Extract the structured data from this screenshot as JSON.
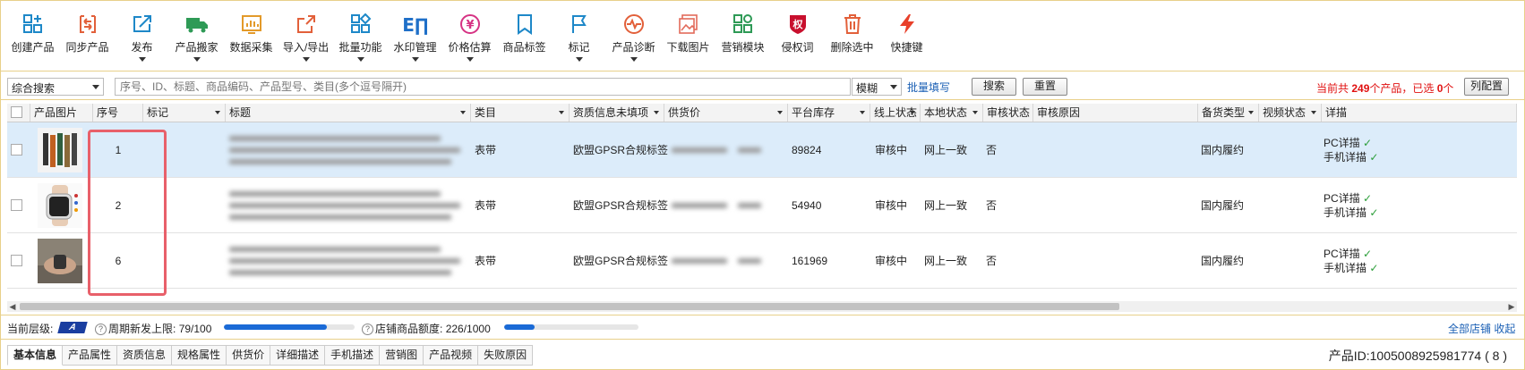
{
  "toolbar": {
    "items": [
      {
        "label": "创建产品",
        "icon": "create-product-icon",
        "arrow": false
      },
      {
        "label": "同步产品",
        "icon": "sync-product-icon",
        "arrow": false
      },
      {
        "label": "发布",
        "icon": "publish-icon",
        "arrow": true
      },
      {
        "label": "产品搬家",
        "icon": "product-move-truck-icon",
        "arrow": true
      },
      {
        "label": "数据采集",
        "icon": "data-collect-icon",
        "arrow": false
      },
      {
        "label": "导入/导出",
        "icon": "import-export-icon",
        "arrow": true
      },
      {
        "label": "批量功能",
        "icon": "batch-grid-icon",
        "arrow": true
      },
      {
        "label": "水印管理",
        "icon": "watermark-icon",
        "arrow": true
      },
      {
        "label": "价格估算",
        "icon": "price-yen-icon",
        "arrow": true
      },
      {
        "label": "商品标签",
        "icon": "bookmark-icon",
        "arrow": false
      },
      {
        "label": "标记",
        "icon": "flag-icon",
        "arrow": true
      },
      {
        "label": "产品诊断",
        "icon": "diagnose-icon",
        "arrow": true
      },
      {
        "label": "下载图片",
        "icon": "download-image-icon",
        "arrow": false
      },
      {
        "label": "营销模块",
        "icon": "marketing-icon",
        "arrow": false
      },
      {
        "label": "侵权词",
        "icon": "infringe-shield-icon",
        "arrow": false
      },
      {
        "label": "删除选中",
        "icon": "trash-icon",
        "arrow": false
      },
      {
        "label": "快捷键",
        "icon": "lightning-icon",
        "arrow": false
      }
    ],
    "infringe_badge": "权",
    "watermark_glyph": "E∏",
    "yen_glyph": "¥"
  },
  "search": {
    "field_select": "综合搜索",
    "placeholder": "序号、ID、标题、商品编码、产品型号、类目(多个逗号隔开)",
    "mode": "模糊",
    "batch_fill": "批量填写",
    "search_btn": "搜索",
    "reset_btn": "重置",
    "summary_prefix": "当前共 ",
    "total": "249",
    "summary_mid": "个产品，已选 ",
    "selected": "0",
    "summary_suffix": "个",
    "columns_btn": "列配置"
  },
  "columns": [
    "产品图片",
    "序号",
    "标记",
    "标题",
    "类目",
    "资质信息未填项",
    "供货价",
    "平台库存",
    "线上状态",
    "本地状态",
    "审核状态",
    "审核原因",
    "备货类型",
    "视频状态",
    "详描"
  ],
  "rows": [
    {
      "seq": "1",
      "category": "表带",
      "qualification": "欧盟GPSR合规标签",
      "stock": "89824",
      "online": "审核中",
      "local": "网上一致",
      "audit": "否",
      "stock_type": "国内履约",
      "pc": "PC详描",
      "mobile": "手机详描",
      "check": "✓",
      "selected": true
    },
    {
      "seq": "2",
      "category": "表带",
      "qualification": "欧盟GPSR合规标签",
      "stock": "54940",
      "online": "审核中",
      "local": "网上一致",
      "audit": "否",
      "stock_type": "国内履约",
      "pc": "PC详描",
      "mobile": "手机详描",
      "check": "✓",
      "selected": false
    },
    {
      "seq": "6",
      "category": "表带",
      "qualification": "欧盟GPSR合规标签",
      "stock": "161969",
      "online": "审核中",
      "local": "网上一致",
      "audit": "否",
      "stock_type": "国内履约",
      "pc": "PC详描",
      "mobile": "手机详描",
      "check": "✓",
      "selected": false
    }
  ],
  "status": {
    "level_label": "当前层级:",
    "level_badge": "A",
    "q": "?",
    "cycle_label": "周期新发上限:",
    "cycle_value": "79/100",
    "cycle_fraction": 0.79,
    "quota_label": "店铺商品额度:",
    "quota_value": "226/1000",
    "quota_fraction": 0.226,
    "all_shops": "全部店铺",
    "collapse": "收起"
  },
  "tabs": [
    "基本信息",
    "产品属性",
    "资质信息",
    "规格属性",
    "供货价",
    "详细描述",
    "手机描述",
    "营销图",
    "产品视频",
    "失败原因"
  ],
  "active_tab": "基本信息",
  "product_id": "产品ID:1005008925981774 ( 8 )",
  "colors": {
    "accent": "#1a5fb4",
    "danger": "#e01010",
    "highlight": "#e8606a",
    "row_selected": "#dcecfa"
  }
}
